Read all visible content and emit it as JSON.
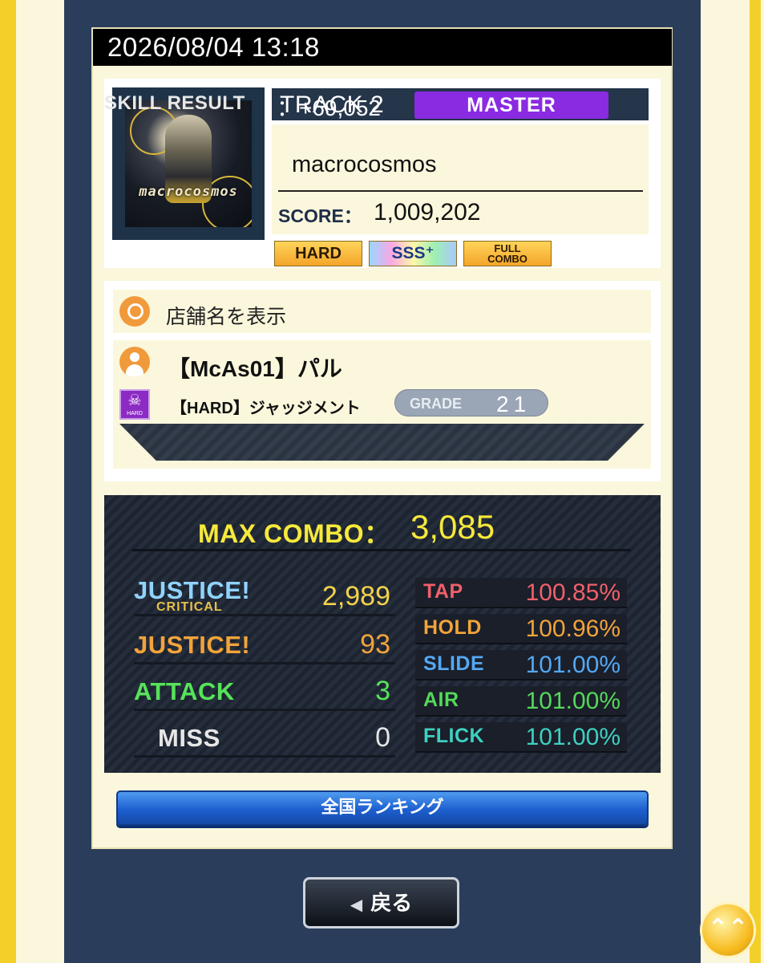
{
  "date": "2026/08/04 13:18",
  "track": {
    "label": "TRACK 2",
    "difficulty": "MASTER",
    "jacket_logo": "macrocosmos",
    "song_title": "macrocosmos",
    "score_label": "SCORE：",
    "score_value": "1,009,202",
    "badges": {
      "clear": "HARD",
      "rank": "SSS⁺",
      "fc_line1": "FULL",
      "fc_line2": "COMBO"
    }
  },
  "store": {
    "label": "店舗名を表示"
  },
  "player": {
    "name": "【McAs01】パル",
    "class_icon_text": "HARD",
    "title": "【HARD】ジャッジメント",
    "grade_label": "GRADE",
    "grade_value": "21",
    "skill_label": "SKILL RESULT",
    "skill_value": "：+69,052"
  },
  "combo": {
    "label": "MAX COMBO：",
    "value": "3,085"
  },
  "judgements": [
    {
      "label": "JUSTICE!",
      "sub": "CRITICAL",
      "value": "2,989",
      "color": "#8fd3ff",
      "value_color": "#f2d24a"
    },
    {
      "label": "JUSTICE!",
      "sub": "",
      "value": "93",
      "color": "#f3a33a",
      "value_color": "#f3a33a"
    },
    {
      "label": "ATTACK",
      "sub": "",
      "value": "3",
      "color": "#56e35a",
      "value_color": "#56e35a"
    },
    {
      "label": "MISS",
      "sub": "",
      "value": "0",
      "color": "#e6e6e6",
      "value_color": "#e6e6e6"
    }
  ],
  "percentages": [
    {
      "label": "TAP",
      "value": "100.85%",
      "color": "#f0606a"
    },
    {
      "label": "HOLD",
      "value": "100.96%",
      "color": "#f2a33a"
    },
    {
      "label": "SLIDE",
      "value": "101.00%",
      "color": "#54a8f2"
    },
    {
      "label": "AIR",
      "value": "101.00%",
      "color": "#55d85a"
    },
    {
      "label": "FLICK",
      "value": "101.00%",
      "color": "#3ed0c0"
    }
  ],
  "buttons": {
    "ranking": "全国ランキング",
    "back": "戻る",
    "top": "⌃⌃"
  }
}
